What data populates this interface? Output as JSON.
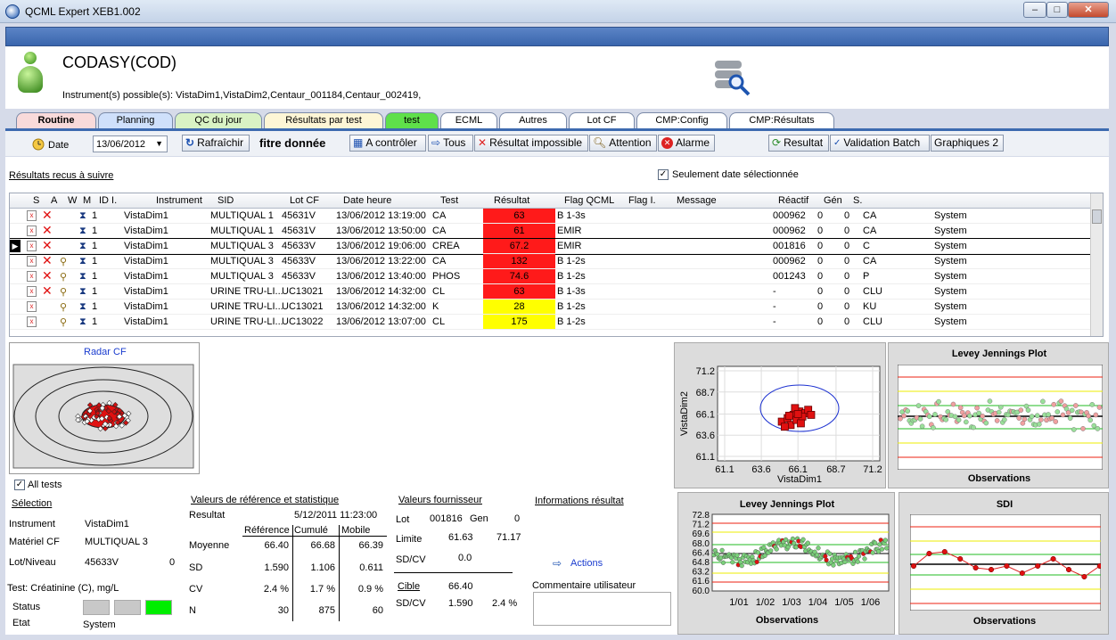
{
  "window": {
    "title": "QCML Expert XEB1.002",
    "min": "–",
    "max": "□",
    "close": "✕"
  },
  "header": {
    "name": "CODASY(COD)",
    "instruments": "Instrument(s) possible(s): VistaDim1,VistaDim2,Centaur_001184,Centaur_002419,"
  },
  "tabs": [
    {
      "label": "Routine",
      "color": "#f9dada"
    },
    {
      "label": "Planning",
      "color": "#cfe0fb"
    },
    {
      "label": "QC du jour",
      "color": "#d9f2c4"
    },
    {
      "label": "Résultats par test",
      "color": "#fdf6d6"
    },
    {
      "label": "test",
      "color": "#5fe04a"
    },
    {
      "label": "ECML",
      "color": "#ffffff"
    },
    {
      "label": "Autres",
      "color": "#ffffff"
    },
    {
      "label": "Lot CF",
      "color": "#ffffff"
    },
    {
      "label": "CMP:Config",
      "color": "#ffffff"
    },
    {
      "label": "CMP:Résultats",
      "color": "#ffffff"
    }
  ],
  "toolbar": {
    "date_label": "Date",
    "date_value": "13/06/2012",
    "refresh": "Rafraîchir",
    "filter": "fitre donnée",
    "a_controler": "A contrôler",
    "tous": "Tous",
    "impossible": "Résultat impossible",
    "attention": "Attention",
    "alarme": "Alarme",
    "resultat": "Resultat",
    "validation": "Validation Batch",
    "graphiques": "Graphiques 2"
  },
  "results": {
    "link": "Résultats recus à suivre",
    "only_selected": "Seulement date sélectionnée",
    "columns": [
      "S",
      "A",
      "W",
      "M",
      "ID I.",
      "Instrument",
      "SID",
      "Lot CF",
      "Date heure",
      "Test",
      "Résultat",
      "Flag QCML",
      "Flag I.",
      "Message",
      "Réactif",
      "Gén",
      "S."
    ],
    "rows": [
      {
        "id": "1",
        "inst": "VistaDim1",
        "sid": "MULTIQUAL 1",
        "lot": "45631V",
        "date": "13/06/2012 13:19:00",
        "test": "CA",
        "res": "63",
        "flag": "B 1-3s",
        "reac": "000962",
        "gen": "0",
        "s": "0",
        "code": "CA",
        "user": "System",
        "color": "#ff1a1a"
      },
      {
        "id": "1",
        "inst": "VistaDim1",
        "sid": "MULTIQUAL 1",
        "lot": "45631V",
        "date": "13/06/2012 13:50:00",
        "test": "CA",
        "res": "61",
        "flag": "EMIR",
        "reac": "000962",
        "gen": "0",
        "s": "0",
        "code": "CA",
        "user": "System",
        "color": "#ff1a1a"
      },
      {
        "id": "1",
        "inst": "VistaDim1",
        "sid": "MULTIQUAL 3",
        "lot": "45633V",
        "date": "13/06/2012 19:06:00",
        "test": "CREA",
        "res": "67.2",
        "flag": "EMIR",
        "reac": "001816",
        "gen": "0",
        "s": "0",
        "code": "C",
        "user": "System",
        "color": "#ff1a1a"
      },
      {
        "id": "1",
        "inst": "VistaDim1",
        "sid": "MULTIQUAL 3",
        "lot": "45633V",
        "date": "13/06/2012 13:22:00",
        "test": "CA",
        "res": "132",
        "flag": "B 1-2s",
        "reac": "000962",
        "gen": "0",
        "s": "0",
        "code": "CA",
        "user": "System",
        "color": "#ff1a1a"
      },
      {
        "id": "1",
        "inst": "VistaDim1",
        "sid": "MULTIQUAL 3",
        "lot": "45633V",
        "date": "13/06/2012 13:40:00",
        "test": "PHOS",
        "res": "74.6",
        "flag": "B 1-2s",
        "reac": "001243",
        "gen": "0",
        "s": "0",
        "code": "P",
        "user": "System",
        "color": "#ff1a1a"
      },
      {
        "id": "1",
        "inst": "VistaDim1",
        "sid": "URINE TRU-LI...",
        "lot": "UC13021",
        "date": "13/06/2012 14:32:00",
        "test": "CL",
        "res": "63",
        "flag": "B 1-3s",
        "reac": "-",
        "gen": "0",
        "s": "0",
        "code": "CLU",
        "user": "System",
        "color": "#ff1a1a"
      },
      {
        "id": "1",
        "inst": "VistaDim1",
        "sid": "URINE TRU-LI...",
        "lot": "UC13021",
        "date": "13/06/2012 14:32:00",
        "test": "K",
        "res": "28",
        "flag": "B 1-2s",
        "reac": "-",
        "gen": "0",
        "s": "0",
        "code": "KU",
        "user": "System",
        "color": "#ffff00"
      },
      {
        "id": "1",
        "inst": "VistaDim1",
        "sid": "URINE TRU-LI...",
        "lot": "UC13022",
        "date": "13/06/2012 13:07:00",
        "test": "CL",
        "res": "175",
        "flag": "B 1-2s",
        "reac": "-",
        "gen": "0",
        "s": "0",
        "code": "CLU",
        "user": "System",
        "color": "#ffff00"
      }
    ]
  },
  "radar": {
    "title": "Radar CF"
  },
  "details": {
    "all_tests": "All tests",
    "selection": "Sélection",
    "instrument_label": "Instrument",
    "instrument_value": "VistaDim1",
    "materiel_label": "Matériel CF",
    "materiel_value": "MULTIQUAL 3",
    "lot_label": "Lot/Niveau",
    "lot_value": "45633V",
    "lot_extra": "0",
    "test_label": "Test: Créatinine (C), mg/L",
    "status_label": "Status",
    "etat_label": "Etat",
    "etat_value": "System"
  },
  "ref": {
    "title": "Valeurs de référence et statistique",
    "resultat_label": "Resultat",
    "resultat_date": "5/12/2011 11:23:00",
    "col_ref": "Référence",
    "col_cum": "Cumulé",
    "col_mob": "Mobile",
    "rows": [
      {
        "label": "Moyenne",
        "ref": "66.40",
        "cum": "66.68",
        "mob": "66.39"
      },
      {
        "label": "SD",
        "ref": "1.590",
        "cum": "1.106",
        "mob": "0.611"
      },
      {
        "label": "CV",
        "ref": "2.4 %",
        "cum": "1.7 %",
        "mob": "0.9 %"
      },
      {
        "label": "N",
        "ref": "30",
        "cum": "875",
        "mob": "60"
      }
    ]
  },
  "fournisseur": {
    "title": "Valeurs fournisseur",
    "lot_label": "Lot",
    "lot_value": "001816",
    "gen_label": "Gen",
    "gen_value": "0",
    "limite_label": "Limite",
    "limite_low": "61.63",
    "limite_high": "71.17",
    "sdcv_label": "SD/CV",
    "sdcv_value": "0.0",
    "cible_label": "Cible",
    "cible_value": "66.40",
    "sdcv2_label": "SD/CV",
    "sdcv2_sd": "1.590",
    "sdcv2_cv": "2.4 %"
  },
  "info": {
    "title": "Informations résultat",
    "actions": "Actions",
    "comment_label": "Commentaire utilisateur"
  },
  "chart_data": [
    {
      "type": "scatter",
      "title": "",
      "xlabel": "VistaDim1",
      "ylabel": "VistaDim2",
      "xticks": [
        "61.1",
        "63.6",
        "66.1",
        "68.7",
        "71.2"
      ],
      "yticks": [
        "71.2",
        "68.7",
        "66.1",
        "63.6",
        "61.1"
      ],
      "xlim": [
        61.1,
        71.2
      ],
      "ylim": [
        61.1,
        71.2
      ],
      "points": [
        [
          65.0,
          65.2
        ],
        [
          65.4,
          65.6
        ],
        [
          65.8,
          66.0
        ],
        [
          66.2,
          66.4
        ],
        [
          66.6,
          66.2
        ],
        [
          65.6,
          64.8
        ],
        [
          66.0,
          65.4
        ],
        [
          66.4,
          65.8
        ],
        [
          66.8,
          66.6
        ],
        [
          65.2,
          64.6
        ],
        [
          65.9,
          66.8
        ],
        [
          66.3,
          65.0
        ],
        [
          67.0,
          66.0
        ],
        [
          65.5,
          65.9
        ],
        [
          66.1,
          66.1
        ]
      ]
    },
    {
      "type": "line",
      "title": "Levey Jennings Plot",
      "xlabel": "Observations"
    },
    {
      "type": "line",
      "title": "Levey Jennings Plot",
      "xlabel": "Observations",
      "yticks": [
        "72.8",
        "71.2",
        "69.6",
        "68.0",
        "66.4",
        "64.8",
        "63.2",
        "61.6",
        "60.0"
      ],
      "xticks": [
        "1/01",
        "1/02",
        "1/03",
        "1/04",
        "1/05",
        "1/06"
      ]
    },
    {
      "type": "line",
      "title": "SDI",
      "xlabel": "Observations"
    }
  ]
}
